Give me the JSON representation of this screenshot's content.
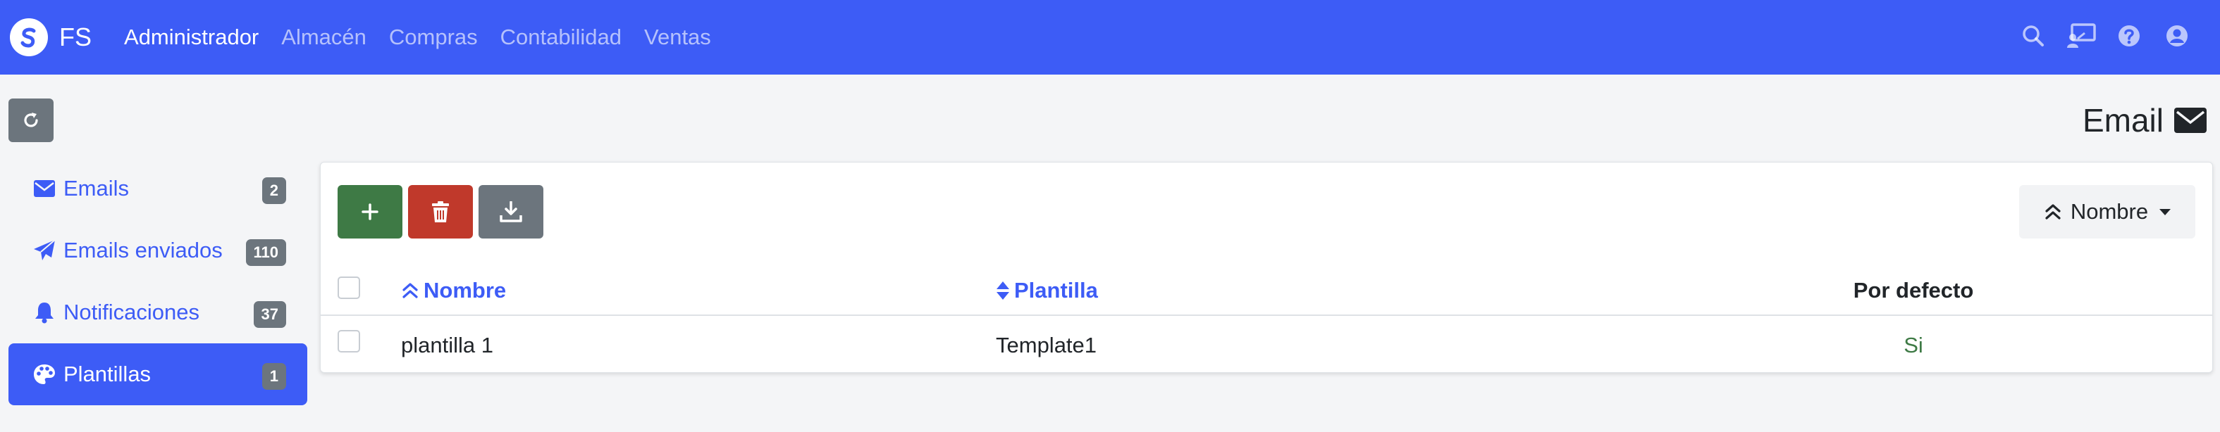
{
  "navbar": {
    "brand": "FS",
    "menu": [
      "Administrador",
      "Almacén",
      "Compras",
      "Contabilidad",
      "Ventas"
    ],
    "active_index": 0
  },
  "page": {
    "title": "Email"
  },
  "sidebar": {
    "items": [
      {
        "label": "Emails",
        "badge": "2"
      },
      {
        "label": "Emails enviados",
        "badge": "110"
      },
      {
        "label": "Notificaciones",
        "badge": "37"
      },
      {
        "label": "Plantillas",
        "badge": "1"
      }
    ],
    "active_index": 3
  },
  "toolbar": {
    "sort_label": "Nombre"
  },
  "table": {
    "headers": {
      "name": "Nombre",
      "template": "Plantilla",
      "default": "Por defecto"
    },
    "rows": [
      {
        "name": "plantilla 1",
        "template": "Template1",
        "default": "Si"
      }
    ]
  },
  "colors": {
    "primary": "#3d5cf6",
    "success": "#3e7a45",
    "danger": "#c0392b",
    "secondary": "#6c757d"
  }
}
